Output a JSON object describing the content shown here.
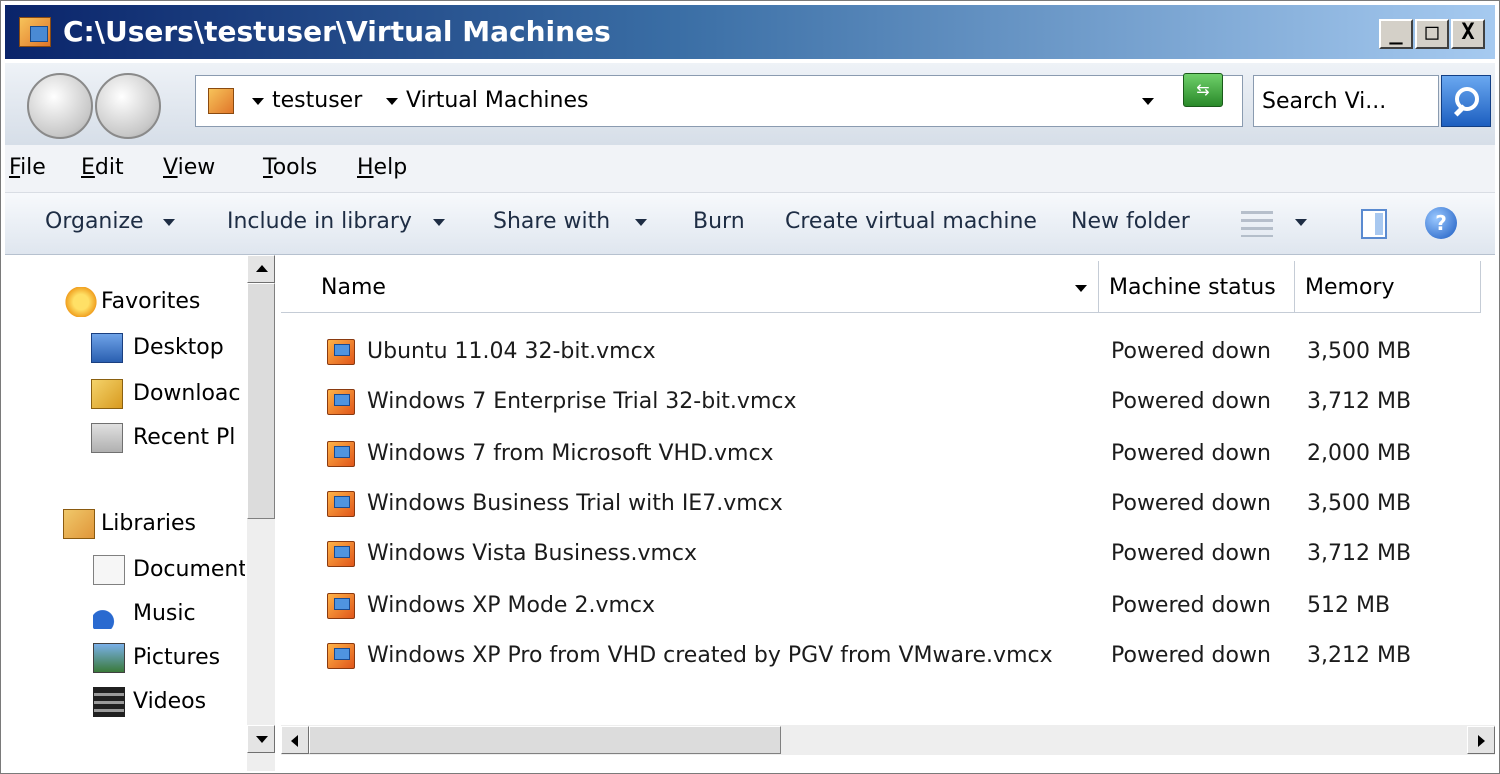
{
  "window": {
    "title": "C:\\Users\\testuser\\Virtual Machines",
    "minimize": "_",
    "maximize": "□",
    "close": "X"
  },
  "address": {
    "crumbs": [
      "testuser",
      "Virtual Machines"
    ],
    "refresh_symbol": "⇆"
  },
  "search": {
    "placeholder": "Search Vi..."
  },
  "menubar": {
    "items": [
      {
        "u": "F",
        "rest": "ile"
      },
      {
        "u": "E",
        "rest": "dit"
      },
      {
        "u": "V",
        "rest": "iew"
      },
      {
        "u": "T",
        "rest": "ools"
      },
      {
        "u": "H",
        "rest": "elp"
      }
    ]
  },
  "toolbar": {
    "organize": "Organize",
    "include": "Include in library",
    "share": "Share with",
    "burn": "Burn",
    "create_vm": "Create virtual machine",
    "new_folder": "New folder",
    "help": "?"
  },
  "navpane": {
    "favorites": "Favorites",
    "desktop": "Desktop",
    "downloads": "Downloac",
    "recent": "Recent Pl",
    "libraries": "Libraries",
    "documents": "Document",
    "music": "Music",
    "pictures": "Pictures",
    "videos": "Videos"
  },
  "columns": {
    "name": "Name",
    "status": "Machine status",
    "memory": "Memory"
  },
  "files": [
    {
      "name": "Ubuntu 11.04 32-bit.vmcx",
      "status": "Powered down",
      "memory": "3,500 MB"
    },
    {
      "name": "Windows 7 Enterprise Trial 32-bit.vmcx",
      "status": "Powered down",
      "memory": "3,712 MB"
    },
    {
      "name": "Windows 7 from Microsoft VHD.vmcx",
      "status": "Powered down",
      "memory": "2,000 MB"
    },
    {
      "name": "Windows Business Trial with IE7.vmcx",
      "status": "Powered down",
      "memory": "3,500 MB"
    },
    {
      "name": "Windows Vista Business.vmcx",
      "status": "Powered down",
      "memory": "3,712 MB"
    },
    {
      "name": "Windows XP Mode 2.vmcx",
      "status": "Powered down",
      "memory": "512 MB"
    },
    {
      "name": "Windows XP Pro from VHD created by PGV from VMware.vmcx",
      "status": "Powered down",
      "memory": "3,212 MB"
    }
  ]
}
